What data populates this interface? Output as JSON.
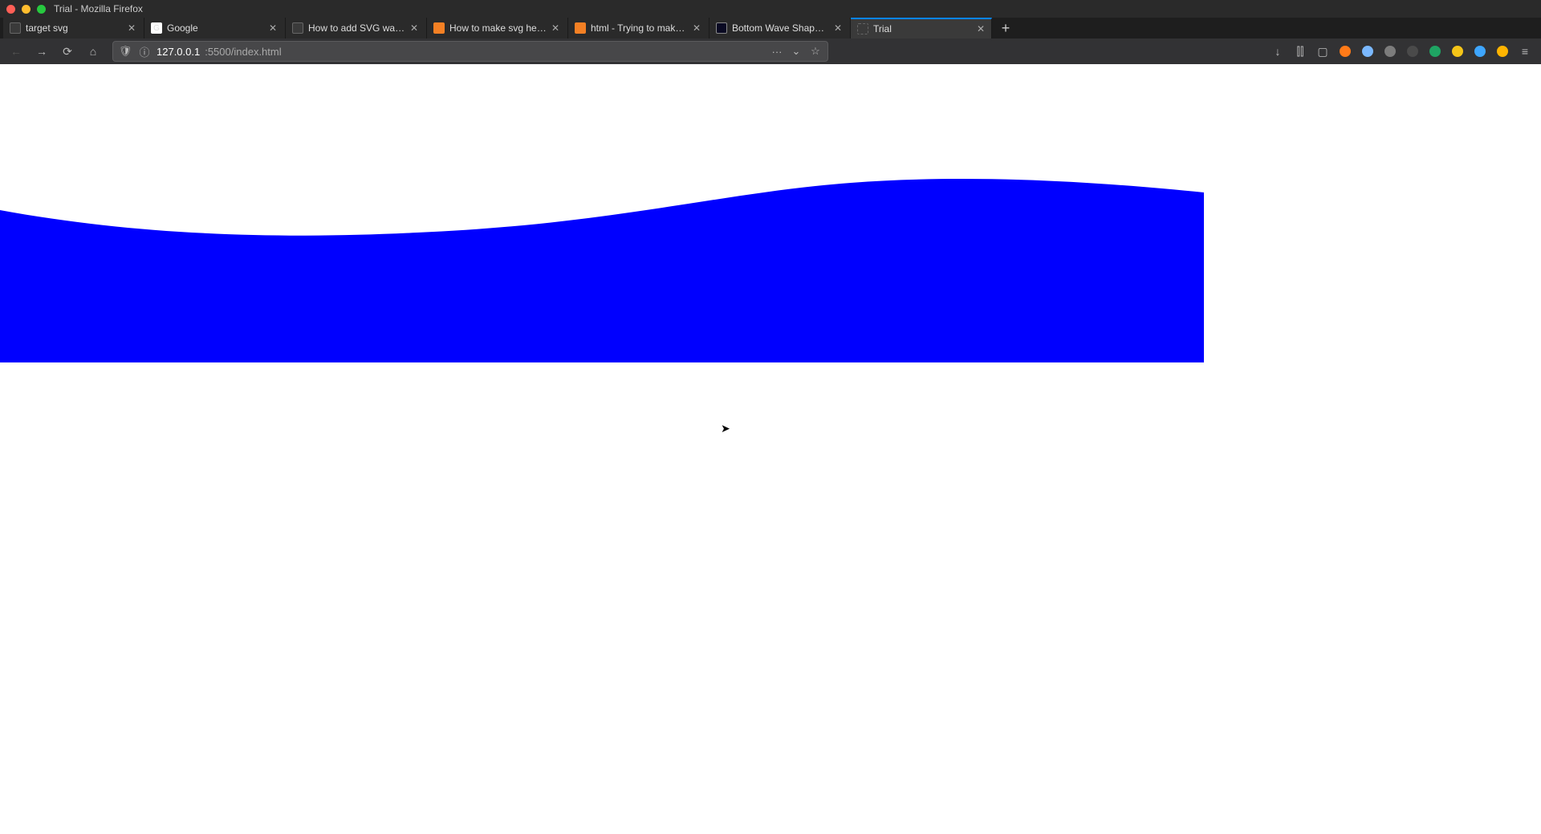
{
  "window": {
    "title": "Trial - Mozilla Firefox"
  },
  "tabs": [
    {
      "label": "target svg",
      "active": false,
      "favicon": "gs"
    },
    {
      "label": "Google",
      "active": false,
      "favicon": "go"
    },
    {
      "label": "How to add SVG waves to y",
      "active": false,
      "favicon": "gs"
    },
    {
      "label": "How to make svg height sa",
      "active": false,
      "favicon": "so"
    },
    {
      "label": "html - Trying to make SVG",
      "active": false,
      "favicon": "so"
    },
    {
      "label": "Bottom Wave Shape Effect",
      "active": false,
      "favicon": "fc"
    },
    {
      "label": "Trial",
      "active": true,
      "favicon": "blank"
    }
  ],
  "url": {
    "host": "127.0.0.1",
    "port_path": ":5500/index.html"
  },
  "icons": {
    "close": "✕",
    "plus": "+",
    "back": "←",
    "forward": "→",
    "reload": "⟳",
    "home": "⌂",
    "shield": "🛡",
    "info": "ⓘ",
    "dots": "···",
    "pocket": "⌄",
    "star": "☆",
    "download": "↓",
    "library": "⫿⫿",
    "sidebar": "▢",
    "menu": "≡"
  },
  "wave": {
    "fill": "#0000FF"
  },
  "favicon_letter_go": "G"
}
